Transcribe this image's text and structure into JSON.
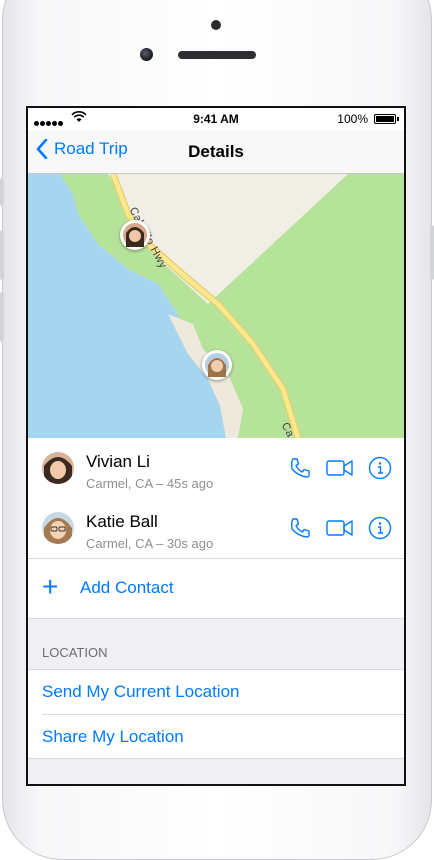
{
  "status_bar": {
    "time": "9:41 AM",
    "battery": "100%",
    "battery_level": 1.0
  },
  "nav": {
    "back_label": "Road Trip",
    "title": "Details"
  },
  "map": {
    "road_label_1": "Cabrillo Hwy",
    "road_label_2": "Ca",
    "colors": {
      "water": "#a6d5ef",
      "park": "#b6e39a",
      "land": "#f1eee6",
      "road": "#fbe890"
    }
  },
  "contacts": [
    {
      "name": "Vivian Li",
      "subtitle": "Carmel, CA – 45s ago"
    },
    {
      "name": "Katie Ball",
      "subtitle": "Carmel, CA – 30s ago"
    }
  ],
  "add_contact_label": "Add Contact",
  "location_section": {
    "header": "LOCATION",
    "items": [
      "Send My Current Location",
      "Share My Location"
    ]
  },
  "accent_color": "#007aff",
  "icons": {
    "back": "chevron-left-icon",
    "phone": "phone-icon",
    "video": "video-camera-icon",
    "info": "info-icon",
    "add": "plus-icon"
  }
}
